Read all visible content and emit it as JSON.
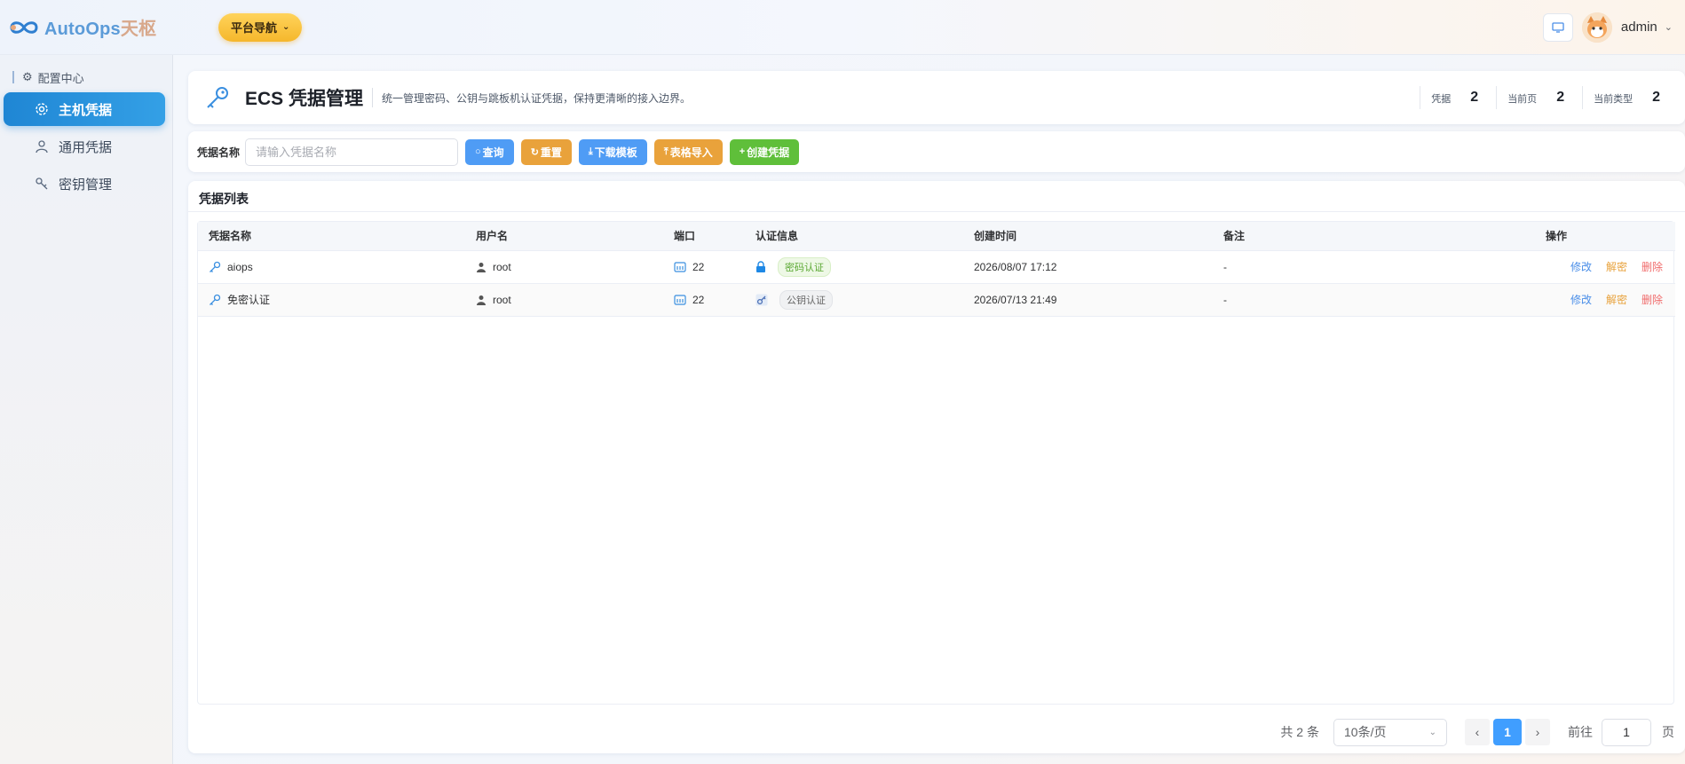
{
  "app": {
    "logo_part1": "AutoOps",
    "logo_part2": "天枢",
    "nav_button": "平台导航",
    "username": "admin"
  },
  "sidebar": {
    "group": "配置中心",
    "items": [
      {
        "label": "主机凭据",
        "icon": "gear-icon",
        "active": true
      },
      {
        "label": "通用凭据",
        "icon": "user-icon",
        "active": false
      },
      {
        "label": "密钥管理",
        "icon": "key-icon",
        "active": false
      }
    ]
  },
  "header": {
    "title": "ECS 凭据管理",
    "description": "统一管理密码、公钥与跳板机认证凭据，保持更清晰的接入边界。",
    "stats": [
      {
        "label": "凭据",
        "value": "2"
      },
      {
        "label": "当前页",
        "value": "2"
      },
      {
        "label": "当前类型",
        "value": "2"
      }
    ]
  },
  "filter": {
    "label": "凭据名称",
    "placeholder": "请输入凭据名称",
    "buttons": {
      "query": "查询",
      "reset": "重置",
      "download": "下载模板",
      "import": "表格导入",
      "create": "创建凭据"
    }
  },
  "table": {
    "title": "凭据列表",
    "columns": [
      "凭据名称",
      "用户名",
      "端口",
      "认证信息",
      "创建时间",
      "备注",
      "操作"
    ],
    "rows": [
      {
        "name": "aiops",
        "username": "root",
        "port": "22",
        "auth": "密码认证",
        "auth_type": "password",
        "created": "2026/08/07 17:12",
        "remark": "-"
      },
      {
        "name": "免密认证",
        "username": "root",
        "port": "22",
        "auth": "公钥认证",
        "auth_type": "pubkey",
        "created": "2026/07/13 21:49",
        "remark": "-"
      }
    ],
    "actions": {
      "edit": "修改",
      "decrypt": "解密",
      "delete": "删除"
    }
  },
  "pagination": {
    "total": "共 2 条",
    "page_size": "10条/页",
    "current": "1",
    "goto_label": "前往",
    "goto_value": "1",
    "page_suffix": "页"
  },
  "colors": {
    "accent": "#409eff",
    "sidebar_active": "#1f86d4",
    "orange": "#e9a23b",
    "green": "#5fbf3a",
    "danger": "#f06c6c"
  }
}
